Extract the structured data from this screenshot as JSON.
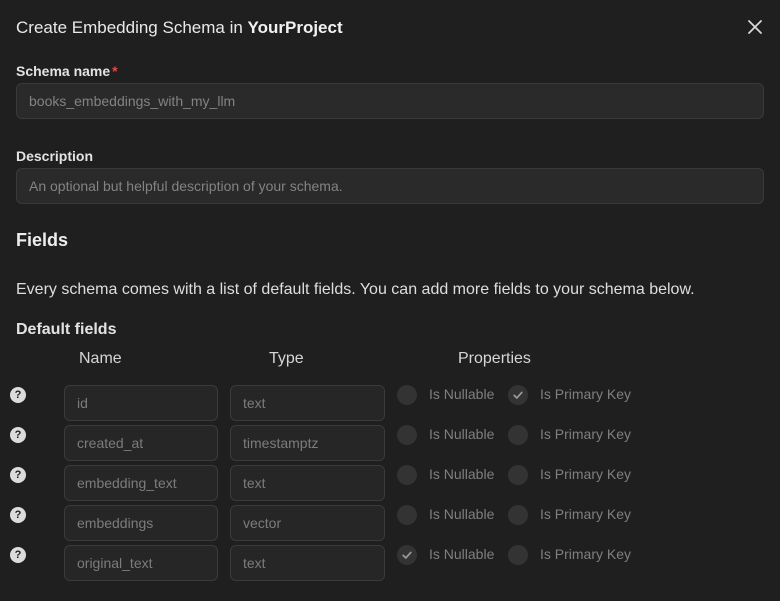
{
  "dialog": {
    "title_prefix": "Create Embedding Schema in",
    "project_name": "YourProject"
  },
  "schema_name": {
    "label": "Schema name",
    "required_marker": "*",
    "placeholder": "books_embeddings_with_my_llm",
    "value": ""
  },
  "description": {
    "label": "Description",
    "placeholder": "An optional but helpful description of your schema.",
    "value": ""
  },
  "fields_section": {
    "title": "Fields",
    "description": "Every schema comes with a list of default fields. You can add more fields to your schema below.",
    "default_fields_title": "Default fields",
    "headers": {
      "name": "Name",
      "type": "Type",
      "properties": "Properties"
    },
    "help_glyph": "?",
    "nullable_label": "Is Nullable",
    "primary_key_label": "Is Primary Key",
    "rows": [
      {
        "name": "id",
        "type": "text",
        "nullable": false,
        "primary_key": true
      },
      {
        "name": "created_at",
        "type": "timestamptz",
        "nullable": false,
        "primary_key": false
      },
      {
        "name": "embedding_text",
        "type": "text",
        "nullable": false,
        "primary_key": false
      },
      {
        "name": "embeddings",
        "type": "vector",
        "nullable": false,
        "primary_key": false
      },
      {
        "name": "original_text",
        "type": "text",
        "nullable": true,
        "primary_key": false
      }
    ]
  },
  "icons": {
    "close": "close-icon",
    "help": "question-circle-icon",
    "check": "check-icon"
  },
  "colors": {
    "background": "#1f1f1f",
    "required": "#e5484d",
    "input_bg": "#2a2a2a"
  }
}
